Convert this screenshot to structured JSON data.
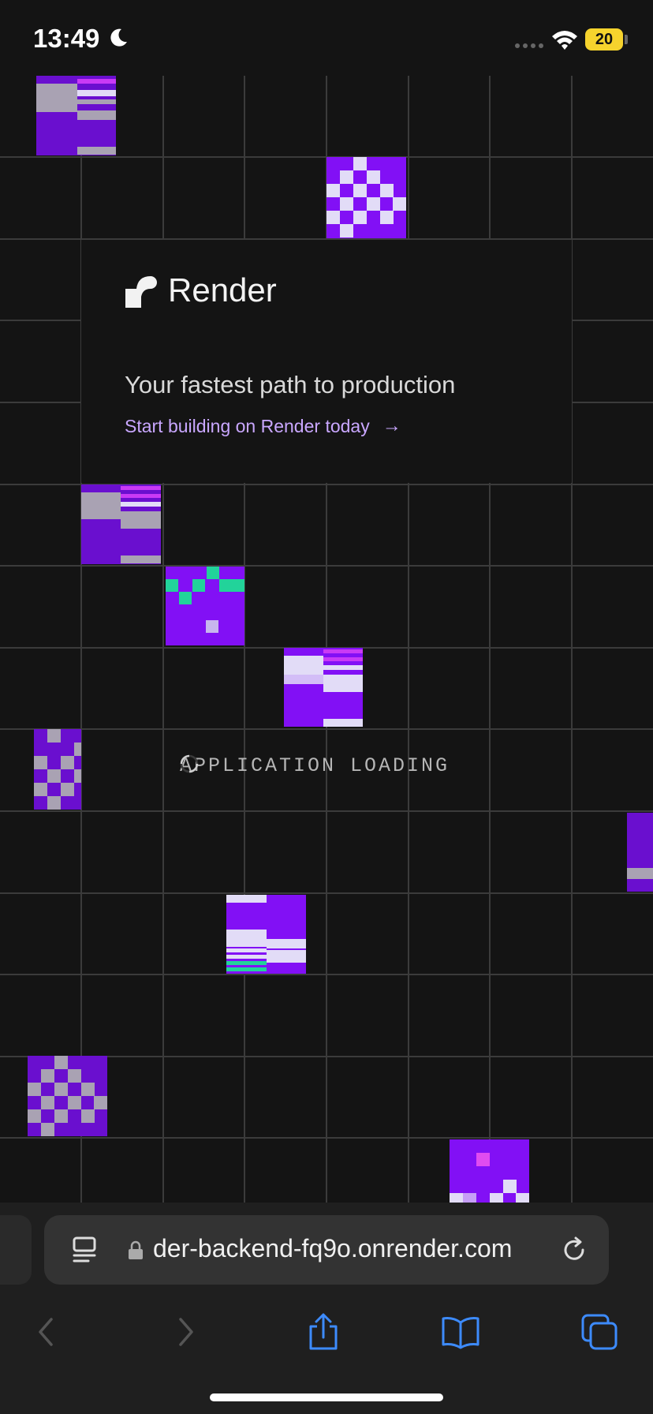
{
  "status_bar": {
    "time": "13:49",
    "battery_level": "20"
  },
  "hero": {
    "brand": "Render",
    "tagline": "Your fastest path to production",
    "cta": "Start building on Render today",
    "cta_arrow": "→"
  },
  "loading": {
    "text": "APPLICATION LOADING"
  },
  "browser": {
    "url": "der-backend-fq9o.onrender.com",
    "icons": [
      "reader-icon",
      "lock-icon",
      "reload-icon",
      "back-icon",
      "forward-icon",
      "share-icon",
      "bookmarks-icon",
      "tabs-icon"
    ]
  },
  "colors": {
    "background": "#141414",
    "grid_line": "#3b3b3b",
    "block_purple": "#8210f5",
    "block_dark_purple": "#6a0fcf",
    "block_light": "#e2dcf7",
    "block_gray": "#a9a2b3",
    "block_magenta": "#c93af5",
    "block_green": "#22d39a",
    "cta": "#c9a7ff",
    "toolbar_icon": "#3d8bfd"
  }
}
